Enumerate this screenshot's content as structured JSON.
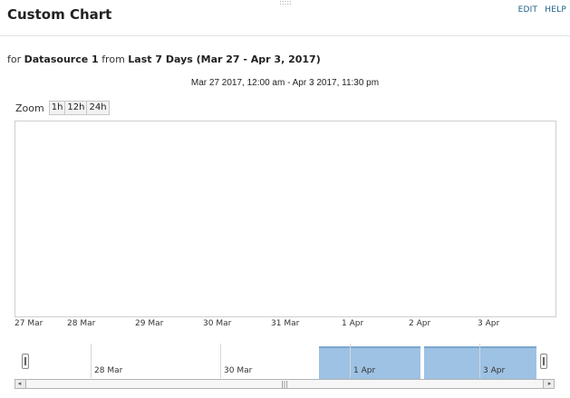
{
  "header": {
    "title": "Custom Chart",
    "edit_label": "EDIT",
    "help_label": "HELP",
    "drag_grip": ":::::"
  },
  "subtitle": {
    "prefix": "for",
    "datasource": "Datasource 1",
    "from_word": "from",
    "range": "Last 7 Days (Mar 27 - Apr 3, 2017)"
  },
  "time_range": "Mar 27 2017, 12:00 am - Apr 3 2017, 11:30 pm",
  "zoom": {
    "label": "Zoom",
    "buttons": [
      "1h",
      "12h",
      "24h"
    ]
  },
  "chart_data": {
    "type": "area",
    "x_ticks": [
      "27 Mar",
      "28 Mar",
      "29 Mar",
      "30 Mar",
      "31 Mar",
      "1 Apr",
      "2 Apr",
      "3 Apr"
    ],
    "series": []
  },
  "navigator": {
    "ticks": [
      "28 Mar",
      "30 Mar",
      "1 Apr",
      "3 Apr"
    ]
  },
  "scrollbar": {
    "left_arrow": "◂",
    "right_arrow": "▸",
    "thumb_grip": "|||"
  }
}
